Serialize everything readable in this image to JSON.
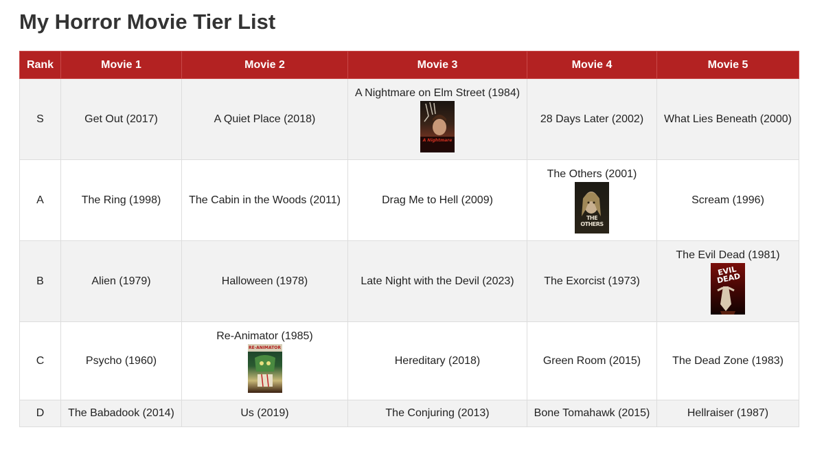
{
  "page": {
    "title": "My Horror Movie Tier List"
  },
  "table": {
    "headers": [
      "Rank",
      "Movie 1",
      "Movie 2",
      "Movie 3",
      "Movie 4",
      "Movie 5"
    ],
    "rows": [
      {
        "rank": "S",
        "movies": [
          "Get Out (2017)",
          "A Quiet Place (2018)",
          "A Nightmare on Elm Street (1984)",
          "28 Days Later (2002)",
          "What Lies Beneath (2000)"
        ]
      },
      {
        "rank": "A",
        "movies": [
          "The Ring (1998)",
          "The Cabin in the Woods (2011)",
          "Drag Me to Hell (2009)",
          "The Others (2001)",
          "Scream (1996)"
        ]
      },
      {
        "rank": "B",
        "movies": [
          "Alien (1979)",
          "Halloween (1978)",
          "Late Night with the Devil (2023)",
          "The Exorcist (1973)",
          "The Evil Dead (1981)"
        ]
      },
      {
        "rank": "C",
        "movies": [
          "Psycho (1960)",
          "Re-Animator (1985)",
          "Hereditary (2018)",
          "Green Room (2015)",
          "The Dead Zone (1983)"
        ]
      },
      {
        "rank": "D",
        "movies": [
          "The Babadook (2014)",
          "Us (2019)",
          "The Conjuring (2013)",
          "Bone Tomahawk (2015)",
          "Hellraiser (1987)"
        ]
      }
    ]
  },
  "posters": {
    "nightmare": {
      "text": "A Nightmare"
    },
    "others": {
      "text": "THE OTHERS"
    },
    "evil_dead": {
      "text": "EVIL DEAD"
    },
    "reanimator": {
      "text": "RE-ANIMATOR"
    }
  },
  "colors": {
    "header_bg": "#b32222",
    "odd_row_bg": "#f2f2f2",
    "even_row_bg": "#ffffff"
  }
}
